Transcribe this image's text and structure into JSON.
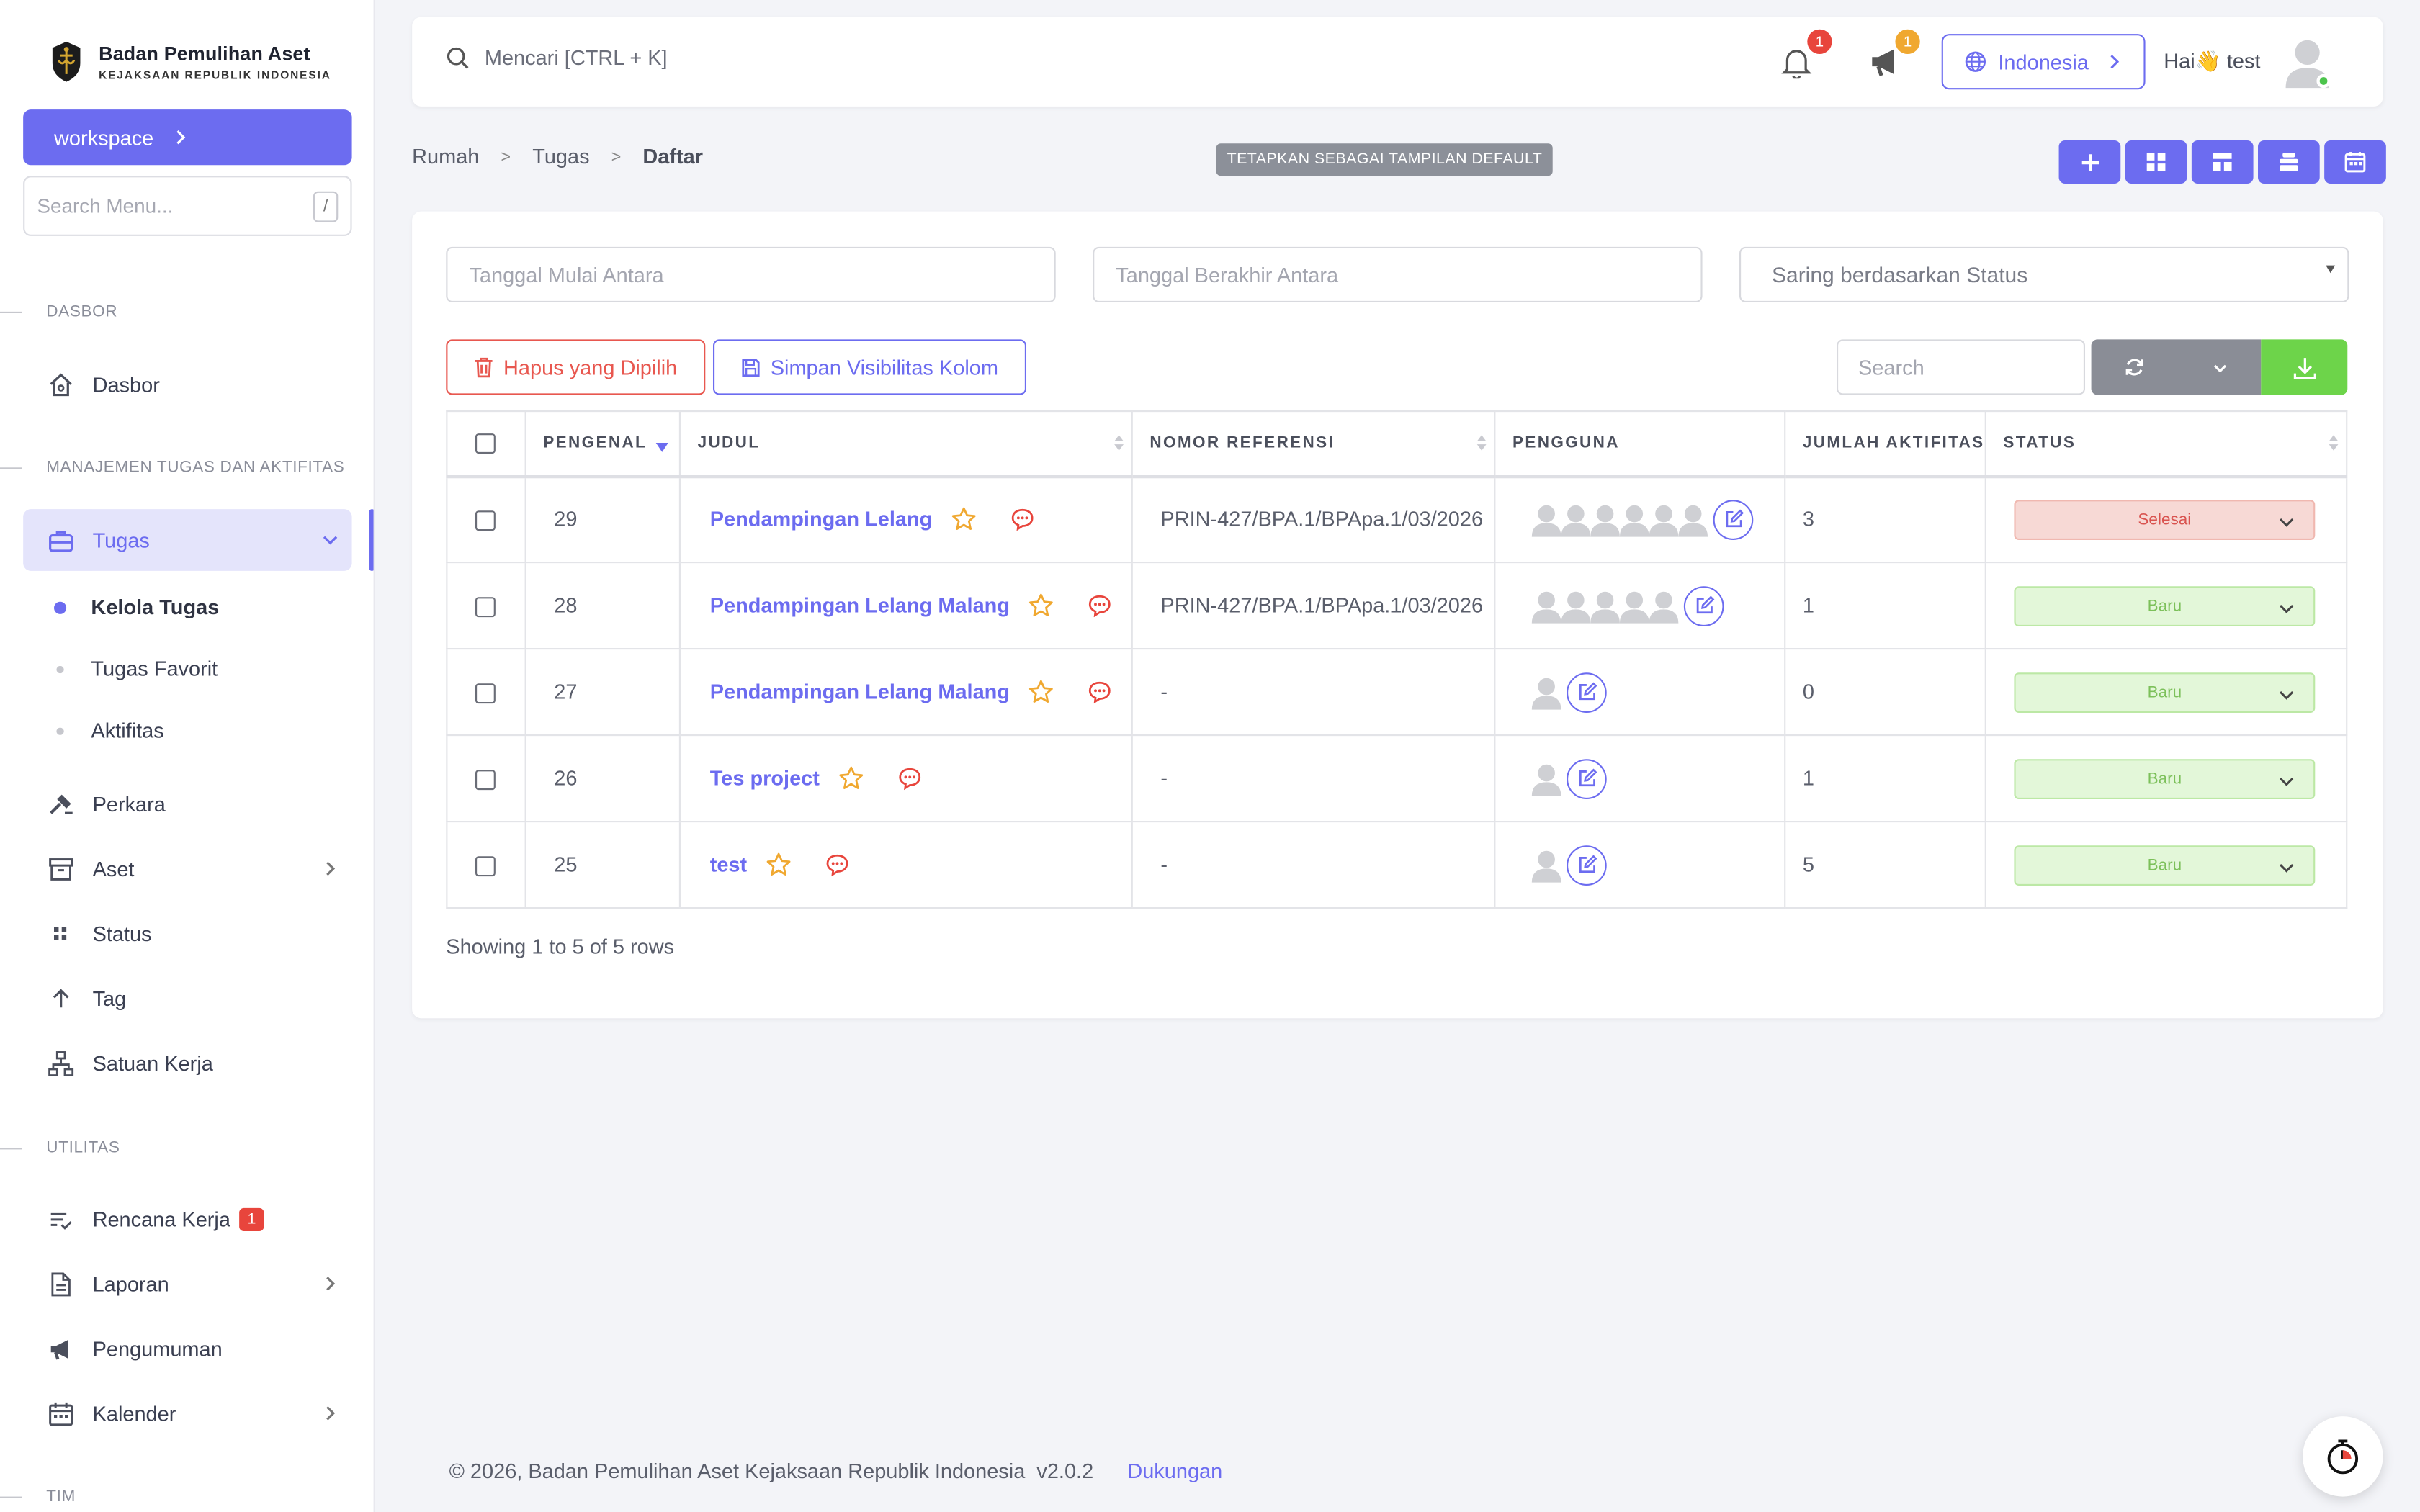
{
  "brand": {
    "title": "Badan Pemulihan Aset",
    "subtitle": "KEJAKSAAN REPUBLIK INDONESIA"
  },
  "sidebar": {
    "workspace_label": "workspace",
    "search_placeholder": "Search Menu...",
    "search_shortcut": "/",
    "sections": {
      "dashboard": "DASBOR",
      "tasks": "MANAJEMEN TUGAS DAN AKTIFITAS",
      "utilities": "UTILITAS",
      "team": "TIM"
    },
    "items": {
      "dashboard": "Dasbor",
      "tasks": "Tugas",
      "manage_tasks": "Kelola Tugas",
      "favorite_tasks": "Tugas Favorit",
      "activities": "Aktifitas",
      "cases": "Perkara",
      "assets": "Aset",
      "status": "Status",
      "tag": "Tag",
      "work_unit": "Satuan Kerja",
      "work_plan": "Rencana Kerja",
      "work_plan_badge": "1",
      "reports": "Laporan",
      "announcements": "Pengumuman",
      "calendar": "Kalender"
    }
  },
  "topbar": {
    "search_placeholder": "Mencari [CTRL + K]",
    "notifications_count": "1",
    "announcements_count": "1",
    "language": "Indonesia",
    "greeting_prefix": "Hai",
    "greeting_emoji": "👋",
    "username": "test"
  },
  "breadcrumb": {
    "home": "Rumah",
    "tasks": "Tugas",
    "current": "Daftar"
  },
  "default_view_label": "TETAPKAN SEBAGAI TAMPILAN DEFAULT",
  "filters": {
    "start_date_placeholder": "Tanggal Mulai Antara",
    "end_date_placeholder": "Tanggal Berakhir Antara",
    "status_placeholder": "Saring berdasarkan Status"
  },
  "actions": {
    "delete_selected": "Hapus yang Dipilih",
    "save_columns": "Simpan Visibilitas Kolom",
    "search_placeholder": "Search"
  },
  "table": {
    "columns": {
      "id": "PENGENAL",
      "title": "JUDUL",
      "ref": "NOMOR REFERENSI",
      "users": "PENGGUNA",
      "activity_count": "JUMLAH AKTIFITAS",
      "status": "STATUS"
    },
    "rows": [
      {
        "id": "29",
        "title": "Pendampingan Lelang",
        "ref": "PRIN-427/BPA.1/BPApa.1/03/2026",
        "user_count": 6,
        "activities": "3",
        "status": "Selesai",
        "status_kind": "done"
      },
      {
        "id": "28",
        "title": "Pendampingan Lelang Malang",
        "ref": "PRIN-427/BPA.1/BPApa.1/03/2026",
        "user_count": 5,
        "activities": "1",
        "status": "Baru",
        "status_kind": "new"
      },
      {
        "id": "27",
        "title": "Pendampingan Lelang Malang",
        "ref": "-",
        "user_count": 1,
        "activities": "0",
        "status": "Baru",
        "status_kind": "new"
      },
      {
        "id": "26",
        "title": "Tes project",
        "ref": "-",
        "user_count": 1,
        "activities": "1",
        "status": "Baru",
        "status_kind": "new"
      },
      {
        "id": "25",
        "title": "test",
        "ref": "-",
        "user_count": 1,
        "activities": "5",
        "status": "Baru",
        "status_kind": "new"
      }
    ],
    "showing_text": "Showing 1 to 5 of 5 rows"
  },
  "footer": {
    "copyright": "© 2026, Badan Pemulihan Aset Kejaksaan Republik Indonesia  v2.0.2",
    "support": "Dukungan"
  },
  "colors": {
    "accent": "#6c6cf0",
    "danger": "#e8574f",
    "success": "#6dd44a"
  }
}
